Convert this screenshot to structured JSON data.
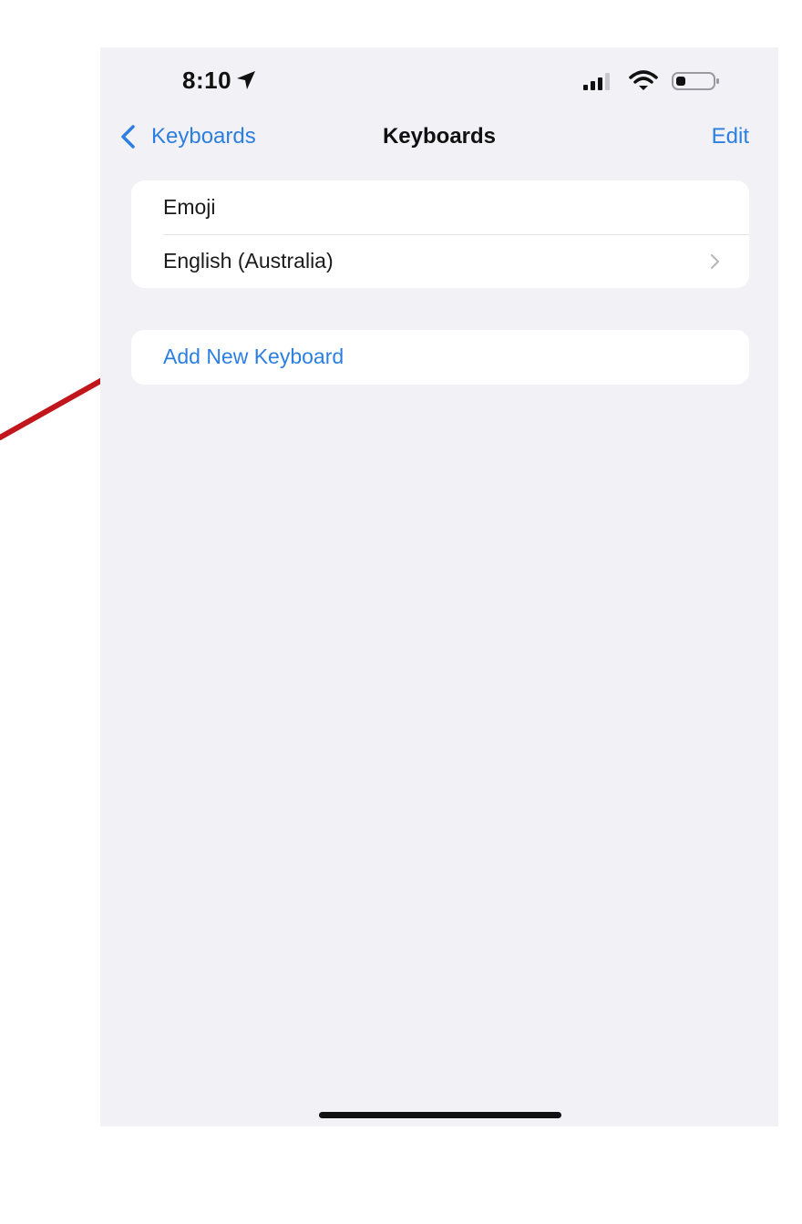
{
  "status_bar": {
    "time": "8:10",
    "icons": [
      "location-arrow-icon",
      "cellular-signal-icon",
      "wifi-icon",
      "battery-icon"
    ]
  },
  "nav": {
    "back_label": "Keyboards",
    "title": "Keyboards",
    "edit_label": "Edit"
  },
  "keyboards": {
    "items": [
      {
        "label": "Emoji",
        "has_chevron": false
      },
      {
        "label": "English (Australia)",
        "has_chevron": true
      }
    ]
  },
  "add_keyboard": {
    "label": "Add New Keyboard"
  },
  "colors": {
    "accent": "#2c7fe0",
    "background": "#f1f1f6",
    "annotation_arrow": "#c0161c"
  }
}
